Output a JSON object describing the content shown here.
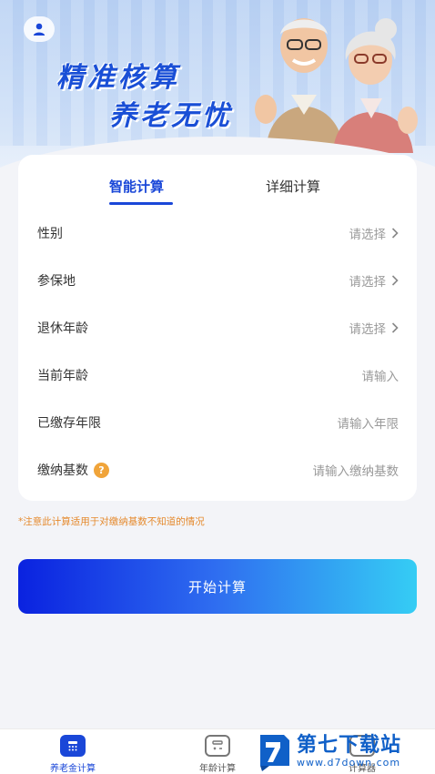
{
  "banner": {
    "slogan_line1": "精准核算",
    "slogan_line2": "养老无忧",
    "avatar_icon": "user-icon"
  },
  "tabs": [
    {
      "label": "智能计算",
      "active": true
    },
    {
      "label": "详细计算",
      "active": false
    }
  ],
  "form": {
    "rows": [
      {
        "label": "性别",
        "value": "请选择",
        "chevron": true
      },
      {
        "label": "参保地",
        "value": "请选择",
        "chevron": true
      },
      {
        "label": "退休年龄",
        "value": "请选择",
        "chevron": true
      },
      {
        "label": "当前年龄",
        "value": "请输入",
        "chevron": false
      },
      {
        "label": "已缴存年限",
        "value": "请输入年限",
        "chevron": false
      },
      {
        "label": "缴纳基数",
        "value": "请输入缴纳基数",
        "chevron": false,
        "help": "?"
      }
    ]
  },
  "note": "*注意此计算适用于对缴纳基数不知道的情况",
  "start_button": "开始计算",
  "bottom_nav": [
    {
      "label": "养老金计算",
      "icon": "calculator-icon",
      "active": true
    },
    {
      "label": "年龄计算",
      "icon": "age-calc-icon",
      "active": false
    },
    {
      "label": "计算器",
      "icon": "calc-icon",
      "active": false
    }
  ],
  "watermark": {
    "title": "第七下载站",
    "url": "www.d7down.com"
  },
  "colors": {
    "accent": "#1a47d8",
    "note": "#e58a2e",
    "help_badge": "#f0a43a",
    "button_start": "#0a22e0",
    "button_end": "#35cdf4"
  }
}
